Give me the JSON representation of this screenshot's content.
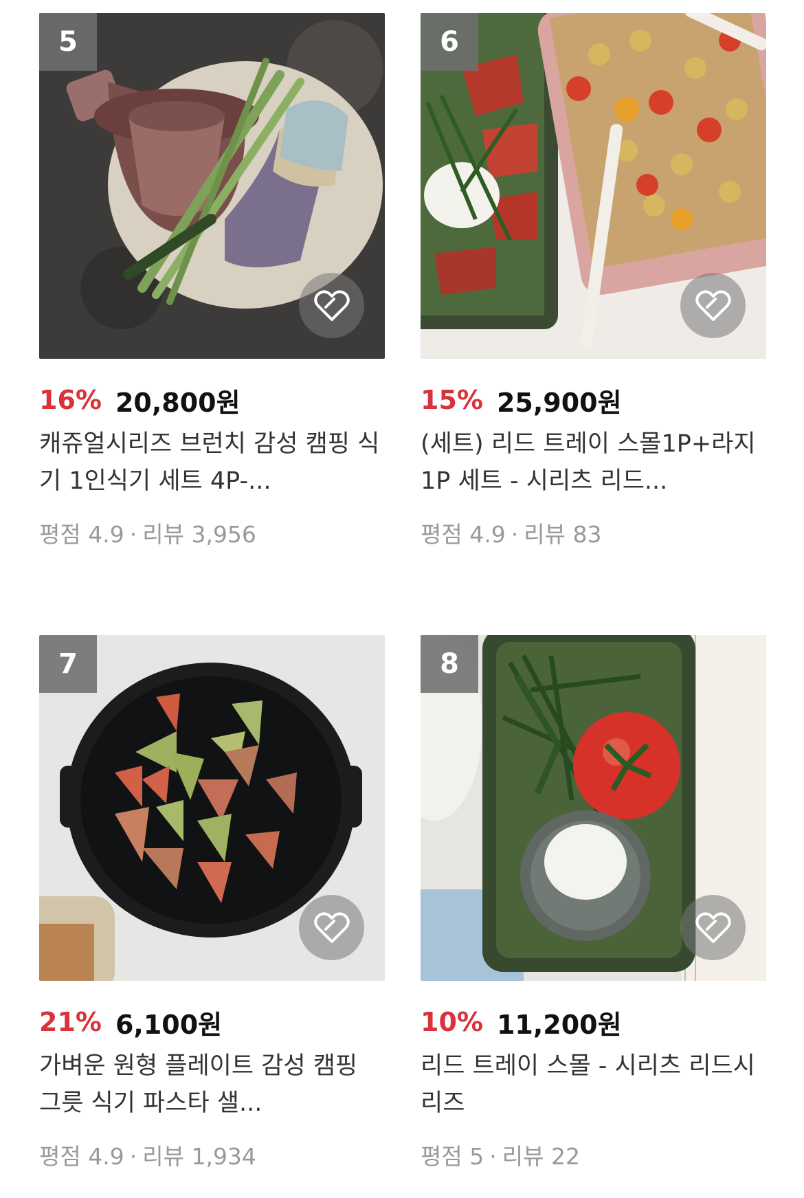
{
  "products": [
    {
      "rank": "5",
      "discount": "16%",
      "price": "20,800원",
      "title": "캐쥬얼시리즈 브런치 감성 캠핑 식기 1인식기 세트 4P-...",
      "rating_label": "평점",
      "rating": "4.9",
      "review_label": "리뷰",
      "reviews": "3,956",
      "image": "camping-cups-asparagus"
    },
    {
      "rank": "6",
      "discount": "15%",
      "price": "25,900원",
      "title": "(세트) 리드 트레이 스몰1P+라지1P 세트 - 시리츠 리드...",
      "rating_label": "평점",
      "rating": "4.9",
      "review_label": "리뷰",
      "reviews": "83",
      "image": "pasta-salad-trays"
    },
    {
      "rank": "7",
      "discount": "21%",
      "price": "6,100원",
      "title": "가벼운 원형 플레이트 감성 캠핑 그릇 식기 파스타 샐...",
      "rating_label": "평점",
      "rating": "4.9",
      "review_label": "리뷰",
      "reviews": "1,934",
      "image": "black-plate-tomatoes"
    },
    {
      "rank": "8",
      "discount": "10%",
      "price": "11,200원",
      "title": "리드 트레이 스몰 - 시리츠 리드시리즈",
      "rating_label": "평점",
      "rating": "5",
      "review_label": "리뷰",
      "reviews": "22",
      "image": "green-tray-tomato-mozzarella"
    }
  ],
  "colors": {
    "discount": "#d9323a",
    "price": "#111111",
    "meta": "#999999"
  },
  "icons": {
    "wishlist": "heart-icon"
  }
}
